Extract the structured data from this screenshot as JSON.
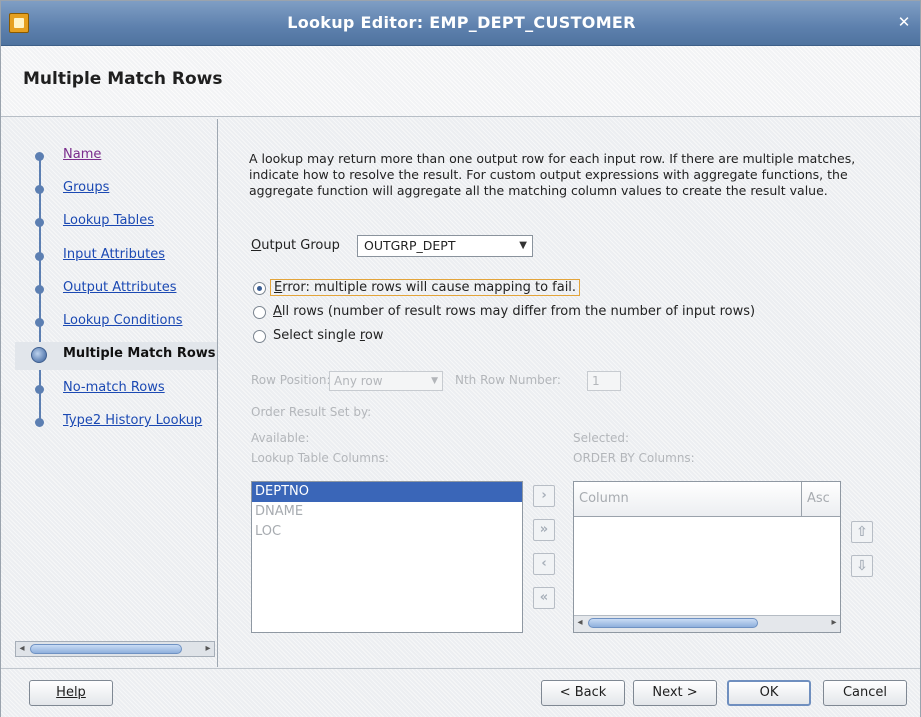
{
  "window": {
    "title": "Lookup Editor: EMP_DEPT_CUSTOMER",
    "close_glyph": "✕"
  },
  "header": {
    "page_title": "Multiple Match Rows"
  },
  "nav": {
    "items": [
      {
        "label": "Name"
      },
      {
        "label": "Groups"
      },
      {
        "label": "Lookup Tables"
      },
      {
        "label": "Input Attributes"
      },
      {
        "label": "Output Attributes"
      },
      {
        "label": "Lookup Conditions"
      },
      {
        "label": "Multiple Match Rows"
      },
      {
        "label": "No-match Rows"
      },
      {
        "label": "Type2 History Lookup"
      }
    ],
    "current_index": 6
  },
  "content": {
    "description": "A lookup may return more than one output row for each input row. If there are multiple matches, indicate how to resolve the result. For custom output expressions with aggregate functions, the aggregate function will aggregate all the matching column values to create the result value.",
    "output_group": {
      "label_underlined": "O",
      "label_rest": "utput Group",
      "value": "OUTGRP_DEPT"
    },
    "options": [
      {
        "mnemonic": "E",
        "rest": "rror: multiple rows will cause mapping to fail.",
        "selected": true
      },
      {
        "mnemonic": "A",
        "rest": "ll rows (number of result rows may differ from the number of input rows)",
        "selected": false
      },
      {
        "prefix": "Select single ",
        "mnemonic": "r",
        "rest": "ow",
        "selected": false
      }
    ],
    "row_position": {
      "label": "Row Position:",
      "value": "Any row",
      "nth_label": "Nth Row Number:",
      "nth_value": "1"
    },
    "order_result_label": "Order Result Set by:",
    "available": {
      "label": "Available:",
      "sublabel": "Lookup Table Columns:",
      "items": [
        "DEPTNO",
        "DNAME",
        "LOC"
      ],
      "selected_index": 0
    },
    "shuttle": [
      "›",
      "»",
      "‹",
      "«"
    ],
    "selected": {
      "label": "Selected:",
      "sublabel": "ORDER BY Columns:",
      "columns": [
        "Column",
        "Asc"
      ]
    },
    "move_up": "⇧",
    "move_down": "⇩"
  },
  "footer": {
    "help": "Help",
    "back": "< Back",
    "next": "Next >",
    "ok": "OK",
    "cancel": "Cancel"
  }
}
